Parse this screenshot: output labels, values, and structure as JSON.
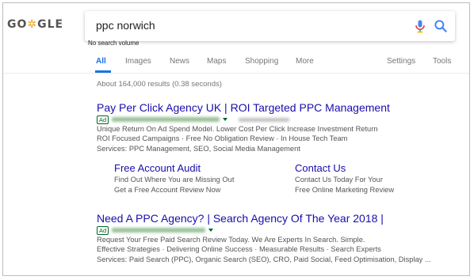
{
  "header": {
    "logo_text": "GO",
    "logo_doodle": "✲",
    "logo_rest": "GLE",
    "search_query": "ppc norwich",
    "volume_note": "No search volume"
  },
  "tabs": [
    {
      "label": "All",
      "active": true
    },
    {
      "label": "Images"
    },
    {
      "label": "News"
    },
    {
      "label": "Maps"
    },
    {
      "label": "Shopping"
    },
    {
      "label": "More"
    },
    {
      "label": "Settings"
    },
    {
      "label": "Tools"
    }
  ],
  "stats": "About 164,000 results (0.38 seconds)",
  "results": [
    {
      "title": "Pay Per Click Agency UK | ROI Targeted PPC Management",
      "ad_label": "Ad",
      "lines": [
        "Unique Return On Ad Spend Model. Lower Cost Per Click Increase Investment Return",
        "ROI Focused Campaigns · Free No Obligation Review · In House Tech Team",
        "Services: PPC Management, SEO, Social Media Management"
      ],
      "sitelinks": [
        {
          "title": "Free Account Audit",
          "lines": [
            "Find Out Where You are Missing Out",
            "Get a Free Account Review Now"
          ]
        },
        {
          "title": "Contact Us",
          "lines": [
            "Contact Us Today For Your",
            "Free Online Marketing Review"
          ]
        }
      ]
    },
    {
      "title": "Need A PPC Agency? | Search Agency Of The Year 2018 |",
      "ad_label": "Ad",
      "lines": [
        "Request Your Free Paid Search Review Today. We Are Experts In Search. Simple.",
        "Effective Strategies · Delivering Online Success · Measurable Results · Search Experts",
        "Services: Paid Search (PPC), Organic Search (SEO), CRO, Paid Social, Feed Optimisation, Display ..."
      ]
    }
  ],
  "colors": {
    "link": "#1a0dab",
    "accent": "#1a73e8",
    "ad_green": "#006621",
    "snippet": "#545454"
  },
  "icons": {
    "mic": "mic-icon",
    "search": "search-icon"
  }
}
